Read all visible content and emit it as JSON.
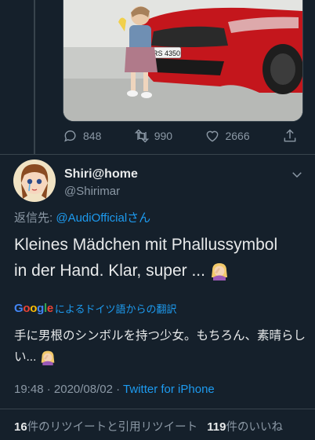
{
  "quoted_media": {
    "plate_text": "RS 4350"
  },
  "actions": {
    "reply_count": "848",
    "retweet_count": "990",
    "like_count": "2666"
  },
  "tweet": {
    "display_name": "Shiri@home",
    "handle": "@Shirimar",
    "reply_prefix": "返信先: ",
    "reply_to": "@AudiOfficialさん",
    "text_line1": "Kleines Mädchen mit Phallussymbol",
    "text_line2": "in der Hand. Klar, super ...",
    "translate_brand": "Google",
    "translate_label": "によるドイツ語からの翻訳",
    "translated_line1": "手に男根のシンボルを持つ少女。もちろん、素晴らし",
    "translated_line2": "い...",
    "time": "19:48",
    "separator": "·",
    "date": "2020/08/02",
    "source": "Twitter for iPhone"
  },
  "stats": {
    "retweets_count": "16",
    "retweets_label": "件のリツイートと引用リツイート",
    "likes_count": "119",
    "likes_label": "件のいいね"
  },
  "colors": {
    "background": "#15202b",
    "accent": "#1d9bf0",
    "muted": "#8b98a5"
  },
  "icons": [
    "reply-icon",
    "retweet-icon",
    "like-icon",
    "share-icon",
    "chevron-down-icon",
    "facepalm-emoji"
  ]
}
